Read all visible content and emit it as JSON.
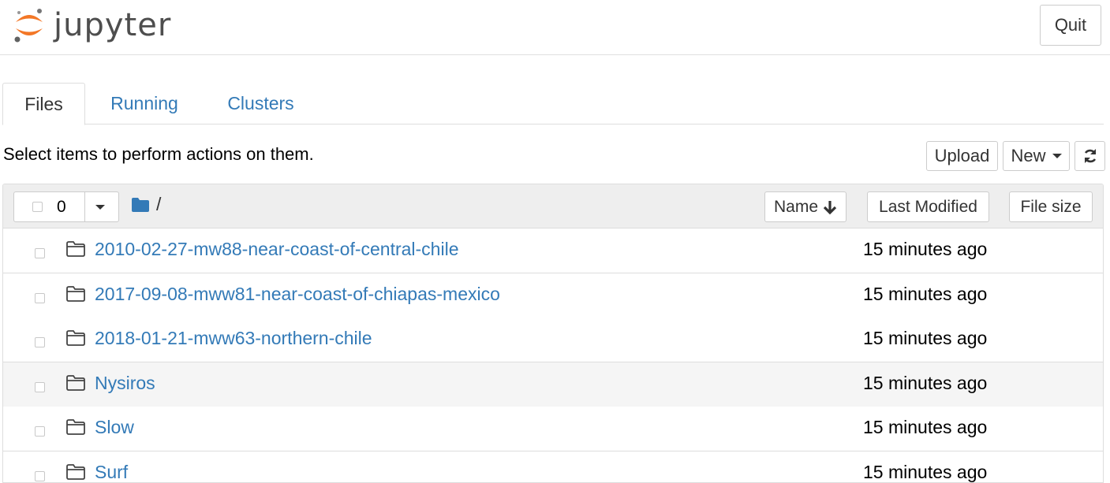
{
  "header": {
    "logo_text": "jupyter",
    "quit_label": "Quit"
  },
  "tabs": [
    {
      "label": "Files",
      "active": true
    },
    {
      "label": "Running",
      "active": false
    },
    {
      "label": "Clusters",
      "active": false
    }
  ],
  "toolbar": {
    "instructions": "Select items to perform actions on them.",
    "upload_label": "Upload",
    "new_label": "New"
  },
  "list": {
    "selected_count": "0",
    "path": "/",
    "sort_name_label": "Name",
    "sort_modified_label": "Last Modified",
    "sort_size_label": "File size",
    "rows": [
      {
        "name": "2010-02-27-mw88-near-coast-of-central-chile",
        "modified": "15 minutes ago"
      },
      {
        "name": "2017-09-08-mww81-near-coast-of-chiapas-mexico",
        "modified": "15 minutes ago"
      },
      {
        "name": "2018-01-21-mww63-northern-chile",
        "modified": "15 minutes ago"
      },
      {
        "name": "Nysiros",
        "modified": "15 minutes ago"
      },
      {
        "name": "Slow",
        "modified": "15 minutes ago"
      },
      {
        "name": "Surf",
        "modified": "15 minutes ago"
      }
    ]
  },
  "colors": {
    "link": "#337ab7",
    "logo_orange": "#f37726",
    "folder_blue": "#337ab7"
  }
}
